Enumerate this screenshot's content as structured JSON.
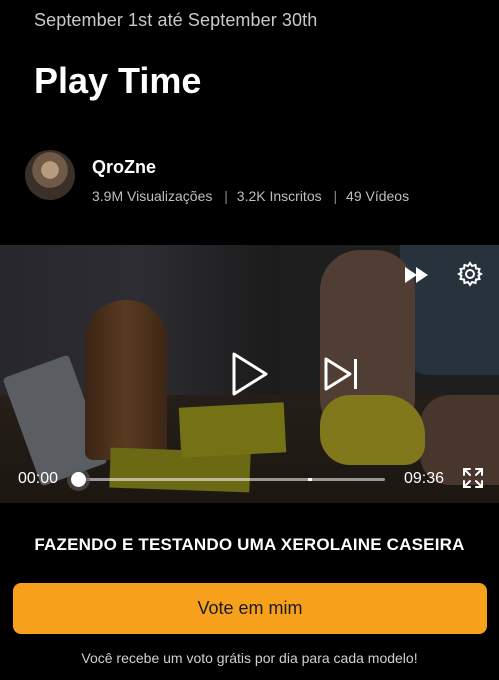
{
  "header": {
    "date_range": "September 1st até September 30th",
    "title": "Play Time"
  },
  "creator": {
    "name": "QroZne",
    "views": "3.9M Visualizações",
    "subscribers": "3.2K Inscritos",
    "videos": "49 Vídeos",
    "separator": "|"
  },
  "player": {
    "current_time": "00:00",
    "duration": "09:36",
    "progress_fraction": 0.0,
    "buffer_marker_fraction": 0.75,
    "icons": {
      "speed": "fast-forward-icon",
      "settings": "gear-icon",
      "play": "play-icon",
      "next": "skip-next-icon",
      "fullscreen": "expand-icon"
    }
  },
  "video_title": "FAZENDO E TESTANDO UMA XEROLAINE CASEIRA",
  "vote": {
    "button_label": "Vote em mim",
    "note": "Você recebe um voto grátis por dia para cada modelo!"
  },
  "colors": {
    "background": "#000000",
    "accent": "#f7a01c"
  }
}
